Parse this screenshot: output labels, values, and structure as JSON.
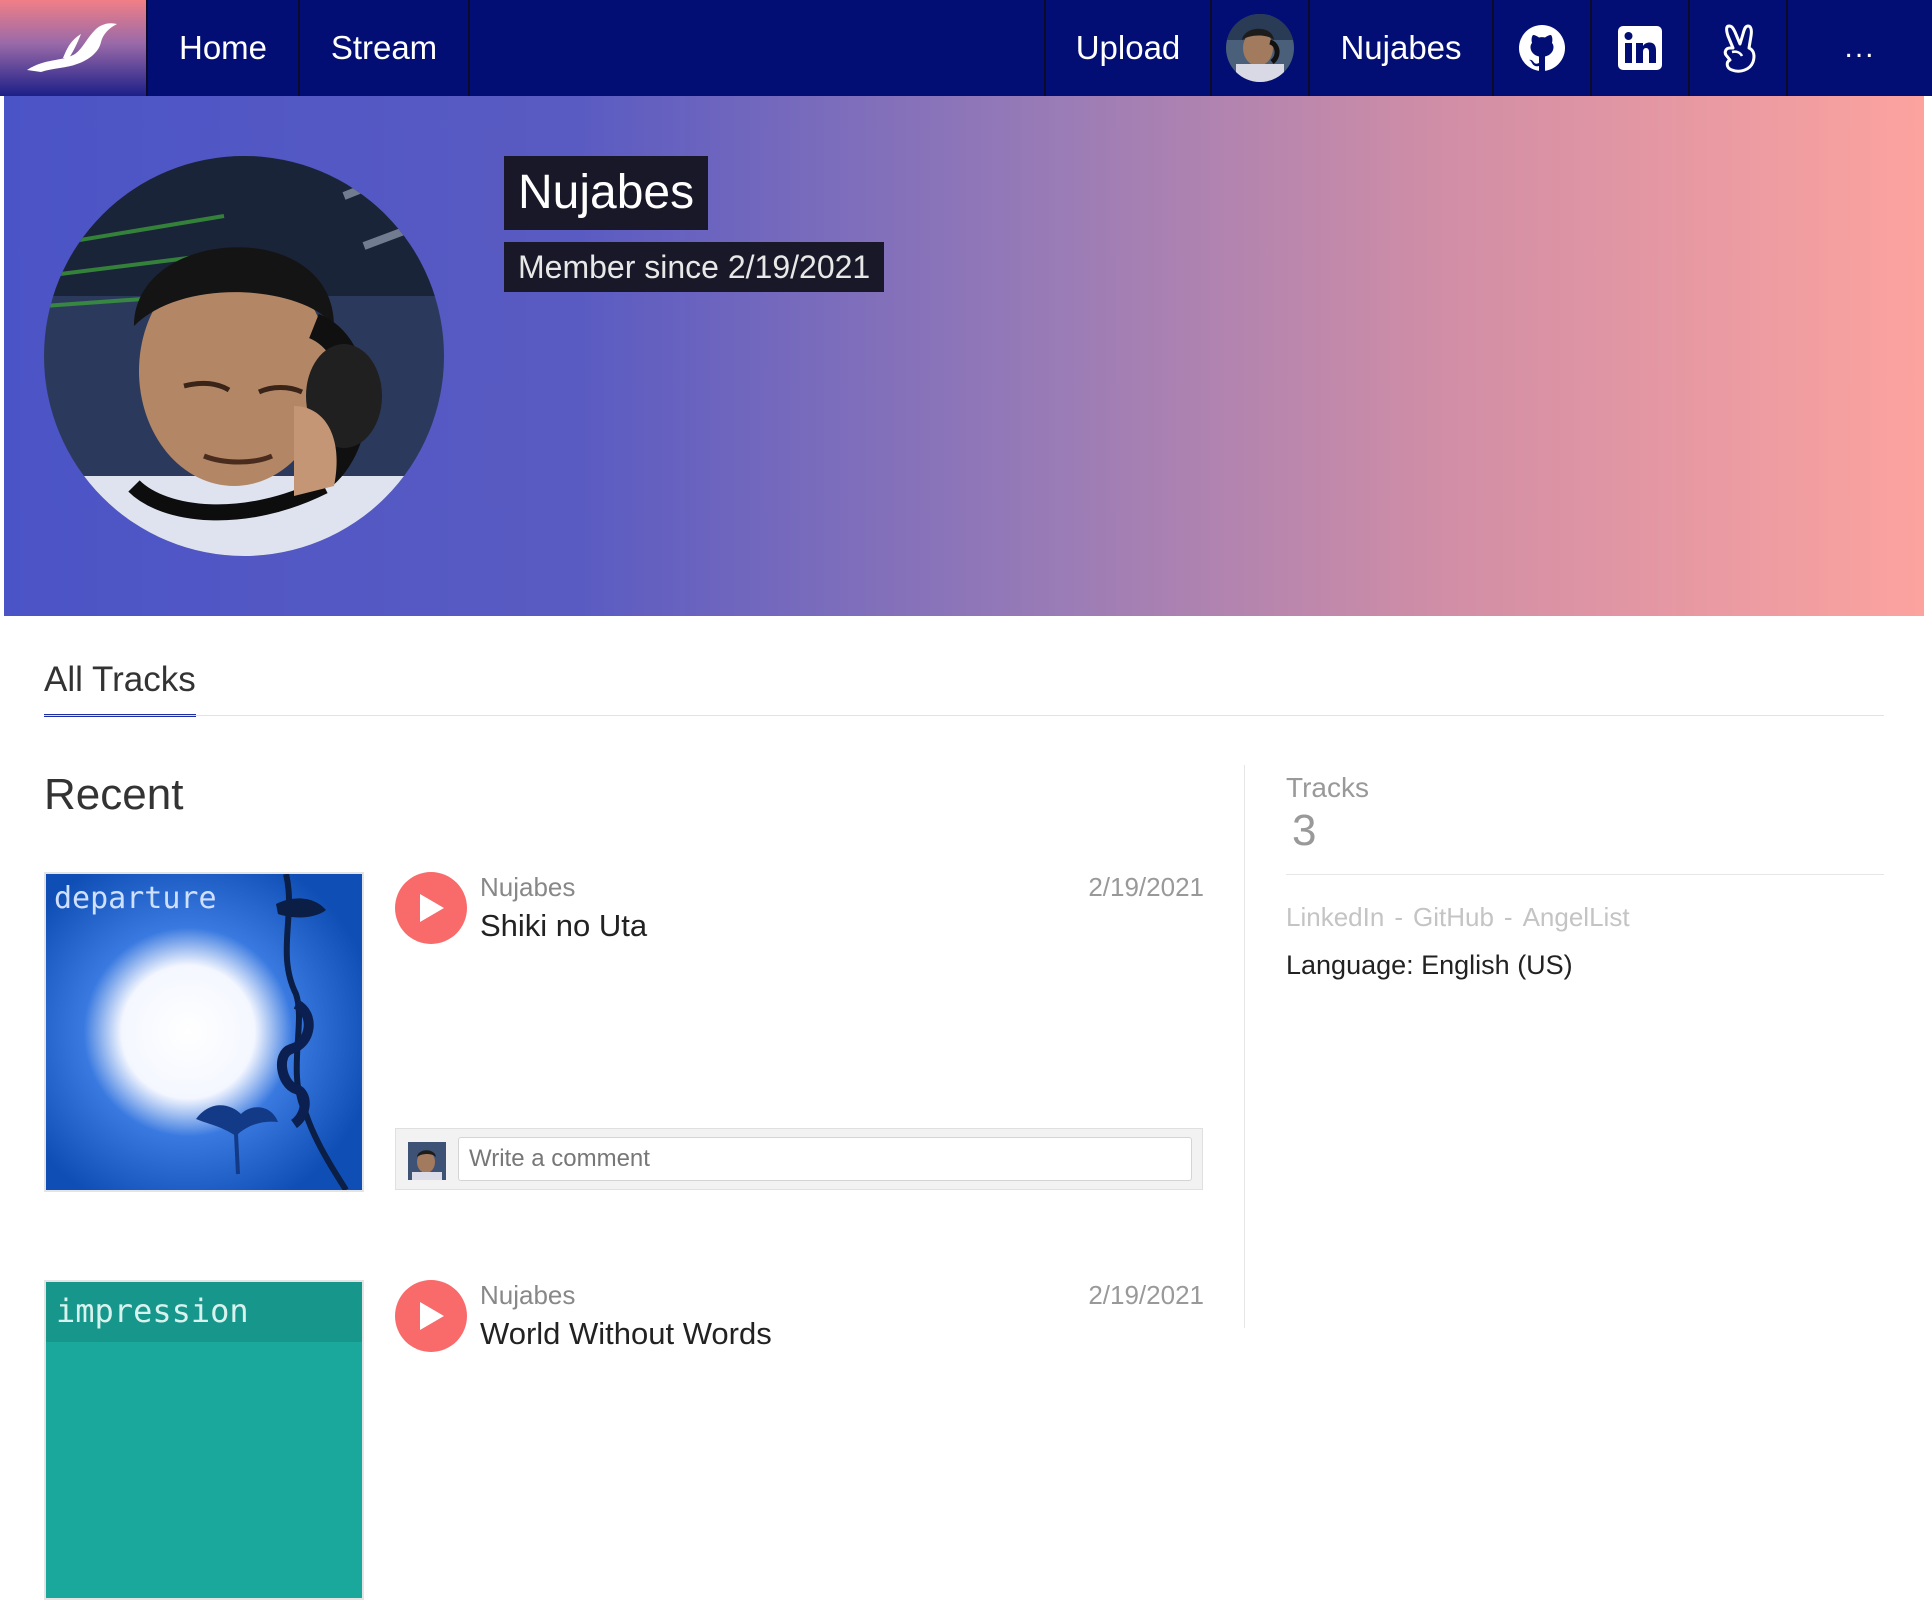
{
  "nav": {
    "home_label": "Home",
    "stream_label": "Stream",
    "upload_label": "Upload",
    "user_label": "Nujabes",
    "more_label": "...",
    "icons": [
      "bird-logo-icon",
      "github-icon",
      "linkedin-icon",
      "angellist-icon"
    ]
  },
  "profile": {
    "name": "Nujabes",
    "member_since": "Member since 2/19/2021"
  },
  "tabs": [
    {
      "label": "All Tracks",
      "active": true
    }
  ],
  "main": {
    "section_heading": "Recent",
    "tracks": [
      {
        "artist": "Nujabes",
        "title": "Shiki no Uta",
        "date": "2/19/2021",
        "art_text": "departure",
        "comment_placeholder": "Write a comment"
      },
      {
        "artist": "Nujabes",
        "title": "World Without Words",
        "date": "2/19/2021",
        "art_text": "impression"
      }
    ]
  },
  "sidebar": {
    "stat_label": "Tracks",
    "stat_value": "3",
    "links": [
      "LinkedIn",
      "GitHub",
      "AngelList"
    ],
    "link_separator": "-",
    "language": "Language: English (US)"
  },
  "colors": {
    "nav_bg": "#020e73",
    "play_button": "#f96a6a",
    "tab_underline": "#1f2fa3",
    "hero_gradient_start": "#4b54c6",
    "hero_gradient_end": "#fca39f"
  }
}
